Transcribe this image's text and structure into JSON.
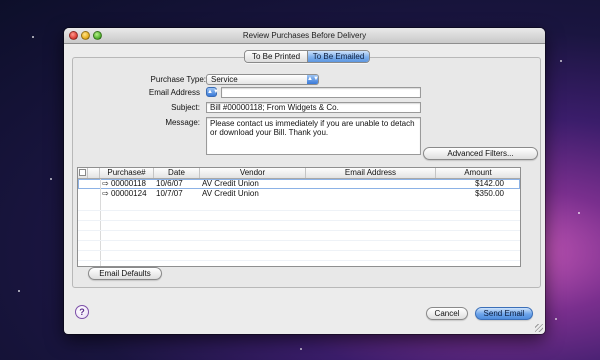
{
  "window": {
    "title": "Review Purchases Before Delivery"
  },
  "tabs": [
    {
      "label": "To Be Printed",
      "active": false
    },
    {
      "label": "To Be Emailed",
      "active": true
    }
  ],
  "form": {
    "purchase_type_label": "Purchase Type:",
    "purchase_type_value": "Service",
    "email_address_label": "Email Address",
    "email_address_value": "",
    "subject_label": "Subject:",
    "subject_value": "Bill #00000118; From Widgets & Co.",
    "message_label": "Message:",
    "message_value": "Please contact us immediately if you are unable to detach or download your Bill. Thank you."
  },
  "buttons": {
    "advanced_filters": "Advanced Filters...",
    "email_defaults": "Email Defaults",
    "cancel": "Cancel",
    "send_email": "Send Email"
  },
  "table": {
    "columns": [
      "",
      "Purchase#",
      "Date",
      "Vendor",
      "Email Address",
      "Amount"
    ],
    "rows": [
      {
        "purchase": "00000118",
        "date": "10/6/07",
        "vendor": "AV Credit Union",
        "email": "",
        "amount": "$142.00"
      },
      {
        "purchase": "00000124",
        "date": "10/7/07",
        "vendor": "AV Credit Union",
        "email": "",
        "amount": "$350.00"
      }
    ]
  },
  "help": {
    "glyph": "?"
  },
  "colors": {
    "accent": "#5d97e0",
    "window_bg": "#ececec"
  },
  "icons": {
    "row_arrow": "arrow-right-icon",
    "help": "help-icon"
  }
}
